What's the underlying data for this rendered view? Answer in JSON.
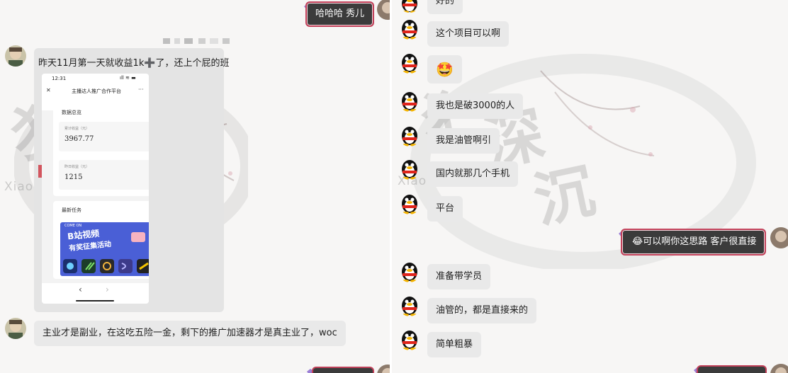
{
  "left": {
    "top_message": "哈哈哈 秀儿",
    "message_1": "昨天11月第一天就收益1k➕了，还上个屁的班",
    "message_2": "主业才是副业，在这吃五险一金，剩下的推广加速器才是真主业了，woc",
    "watermark": "Xiao",
    "screenshot": {
      "time": "12:31",
      "status_icons": "ıll ≋ ▬",
      "close": "✕",
      "title": "主播达人推广合作平台",
      "more": "···",
      "section_title": "数据总览",
      "stat1_label": "累计收益（元）",
      "stat1_value": "3967.77",
      "stat2_label": "昨日收益（元）",
      "stat2_value": "1215",
      "task_title": "最新任务",
      "banner_small": "COME ON",
      "banner_line1": "B站视频",
      "banner_line2": "有奖征集活动",
      "nav_back": "‹",
      "nav_forward": "›"
    }
  },
  "right": {
    "watermark": "Xiao  Luo",
    "messages": [
      "好的",
      "这个项目可以啊",
      "🤩",
      "我也是破3000的人",
      "我是油管啊引",
      "国内就那几个手机",
      "平台",
      "准备带学员",
      "油管的，都是直接来的",
      "简单粗暴"
    ],
    "self_message_emoji": "😂",
    "self_message_text": "可以啊你这思路  客户很直接"
  },
  "colors": {
    "vip_bubble": "#3b3b3b",
    "vip_border": "#c2415a",
    "bubble": "#e9e9e9"
  }
}
